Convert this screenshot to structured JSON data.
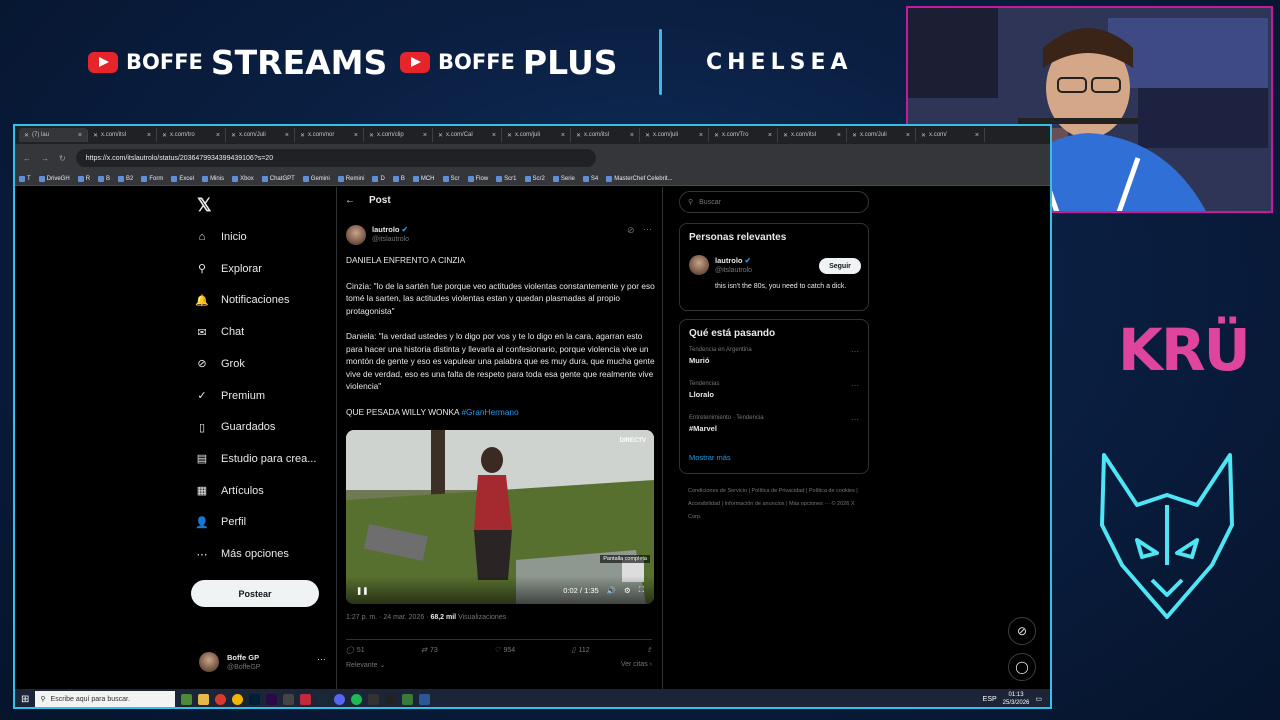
{
  "overlay": {
    "logos": [
      {
        "small": "BOFFE",
        "large": "STREAMS"
      },
      {
        "small": "BOFFE",
        "large": "PLUS"
      }
    ],
    "partner": "CHELSEA",
    "side_logo": "KRÜ"
  },
  "browser": {
    "tabs": [
      {
        "label": "(7) lau",
        "active": true
      },
      {
        "label": "x.com/itsl"
      },
      {
        "label": "x.com/tro"
      },
      {
        "label": "x.com/Juli"
      },
      {
        "label": "x.com/nor"
      },
      {
        "label": "x.com/clip"
      },
      {
        "label": "x.com/Cal"
      },
      {
        "label": "x.com/juli"
      },
      {
        "label": "x.com/itsl"
      },
      {
        "label": "x.com/juli"
      },
      {
        "label": "x.com/Tro"
      },
      {
        "label": "x.com/itsl"
      },
      {
        "label": "x.com/Juli"
      },
      {
        "label": "x.com/"
      }
    ],
    "url": "https://x.com/itslautrolo/status/2036479934399439106?s=20",
    "bookmarks": [
      "T",
      "DriveGH",
      "R",
      "B",
      "B2",
      "Form",
      "Excel",
      "Minis",
      "Xbox",
      "ChatGPT",
      "Gemini",
      "Remini",
      "D",
      "B",
      "MCH",
      "Scr",
      "Flow",
      "Scr1",
      "Scr2",
      "Serie",
      "S4",
      "MasterChef Celebrit..."
    ]
  },
  "nav": {
    "items": [
      "Inicio",
      "Explorar",
      "Notificaciones",
      "Chat",
      "Grok",
      "Premium",
      "Guardados",
      "Estudio para crea...",
      "Artículos",
      "Perfil",
      "Más opciones"
    ],
    "post_button": "Postear",
    "account": {
      "name": "Boffe GP",
      "handle": "@BoffeGP"
    }
  },
  "post": {
    "header": "Post",
    "author": {
      "name": "lautrolo",
      "handle": "@itslautrolo"
    },
    "title": "DANIELA ENFRENTO A CINZIA",
    "p1": "Cinzia: \"lo de la sartén fue porque veo actitudes violentas constantemente y por eso tomé la sarten, las actitudes violentas estan y quedan plasmadas al propio protagonista\"",
    "p2": "Daniela: \"la verdad ustedes y lo digo por vos y te lo digo en la cara, agarran esto para hacer una historia distinta y llevarla al confesionario, porque violencia vive un montón de gente y eso es vapulear una palabra que es muy dura, que mucha gente vive de verdad, eso es una falta de respeto para toda esa gente que realmente vive violencia\"",
    "p3": "QUE PESADA WILLY WONKA",
    "hashtag": "#GranHermano",
    "video": {
      "time": "0:02 / 1:35",
      "tooltip": "Pantalla completa",
      "channel": "DIRECTV"
    },
    "timestamp": "1:27 p. m. · 24 mar. 2026 · ",
    "views_count": "68,2 mil",
    "views_label": " Visualizaciones",
    "stats": {
      "replies": "51",
      "reposts": "73",
      "likes": "954",
      "bookmarks": "112"
    },
    "relevant": "Relevante",
    "quotes": "Ver citas"
  },
  "sidebar": {
    "search_placeholder": "Buscar",
    "people_title": "Personas relevantes",
    "person": {
      "name": "lautrolo",
      "handle": "@itslautrolo",
      "bio": "this isn't the 80s, you need to catch a dick.",
      "follow": "Seguir"
    },
    "trends_title": "Qué está pasando",
    "trends": [
      {
        "context": "Tendencia en Argentina",
        "topic": "Murió"
      },
      {
        "context": "Tendencias",
        "topic": "Lloralo"
      },
      {
        "context": "Entretenimiento · Tendencia",
        "topic": "#Marvel"
      }
    ],
    "show_more": "Mostrar más",
    "footer": "Condiciones de Servicio | Política de Privacidad | Política de cookies | Accesibilidad | Información de anuncios | Más opciones ··· © 2026 X Corp."
  },
  "taskbar": {
    "search_placeholder": "Escribe aquí para buscar.",
    "lang": "ESP",
    "time": "01:13",
    "date": "25/3/2026"
  },
  "colors": {
    "accent": "#1d9bf0",
    "frame": "#35c0e8",
    "cam_border": "#c7199c",
    "youtube": "#e5252a"
  }
}
